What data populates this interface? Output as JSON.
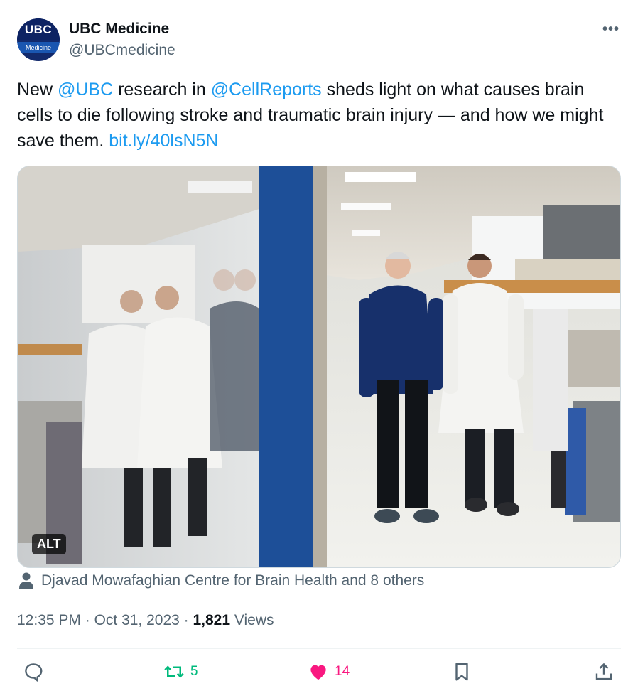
{
  "author": {
    "name": "UBC Medicine",
    "handle": "@UBCmedicine",
    "avatar_text_top": "UBC",
    "avatar_text_bottom": "Medicine"
  },
  "tweet": {
    "text_1": "New ",
    "mention_1": "@UBC",
    "text_2": " research in ",
    "mention_2": "@CellReports",
    "text_3": " sheds light on what causes brain cells to die following stroke and traumatic brain injury — and how we might save them. ",
    "link": "bit.ly/40lsN5N"
  },
  "media": {
    "alt_label": "ALT"
  },
  "tagged": {
    "text": "Djavad Mowafaghian Centre for Brain Health and 8 others"
  },
  "meta": {
    "time": "12:35 PM",
    "separator": " · ",
    "date": "Oct 31, 2023",
    "views_count": "1,821",
    "views_label": " Views"
  },
  "actions": {
    "retweets": "5",
    "likes": "14"
  },
  "colors": {
    "link": "#1d9bf0",
    "retweet": "#00ba7c",
    "like": "#f91880",
    "secondary_text": "#536471"
  },
  "icons": [
    "more-icon",
    "person-icon",
    "reply-icon",
    "retweet-icon",
    "like-icon",
    "bookmark-icon",
    "share-icon"
  ]
}
